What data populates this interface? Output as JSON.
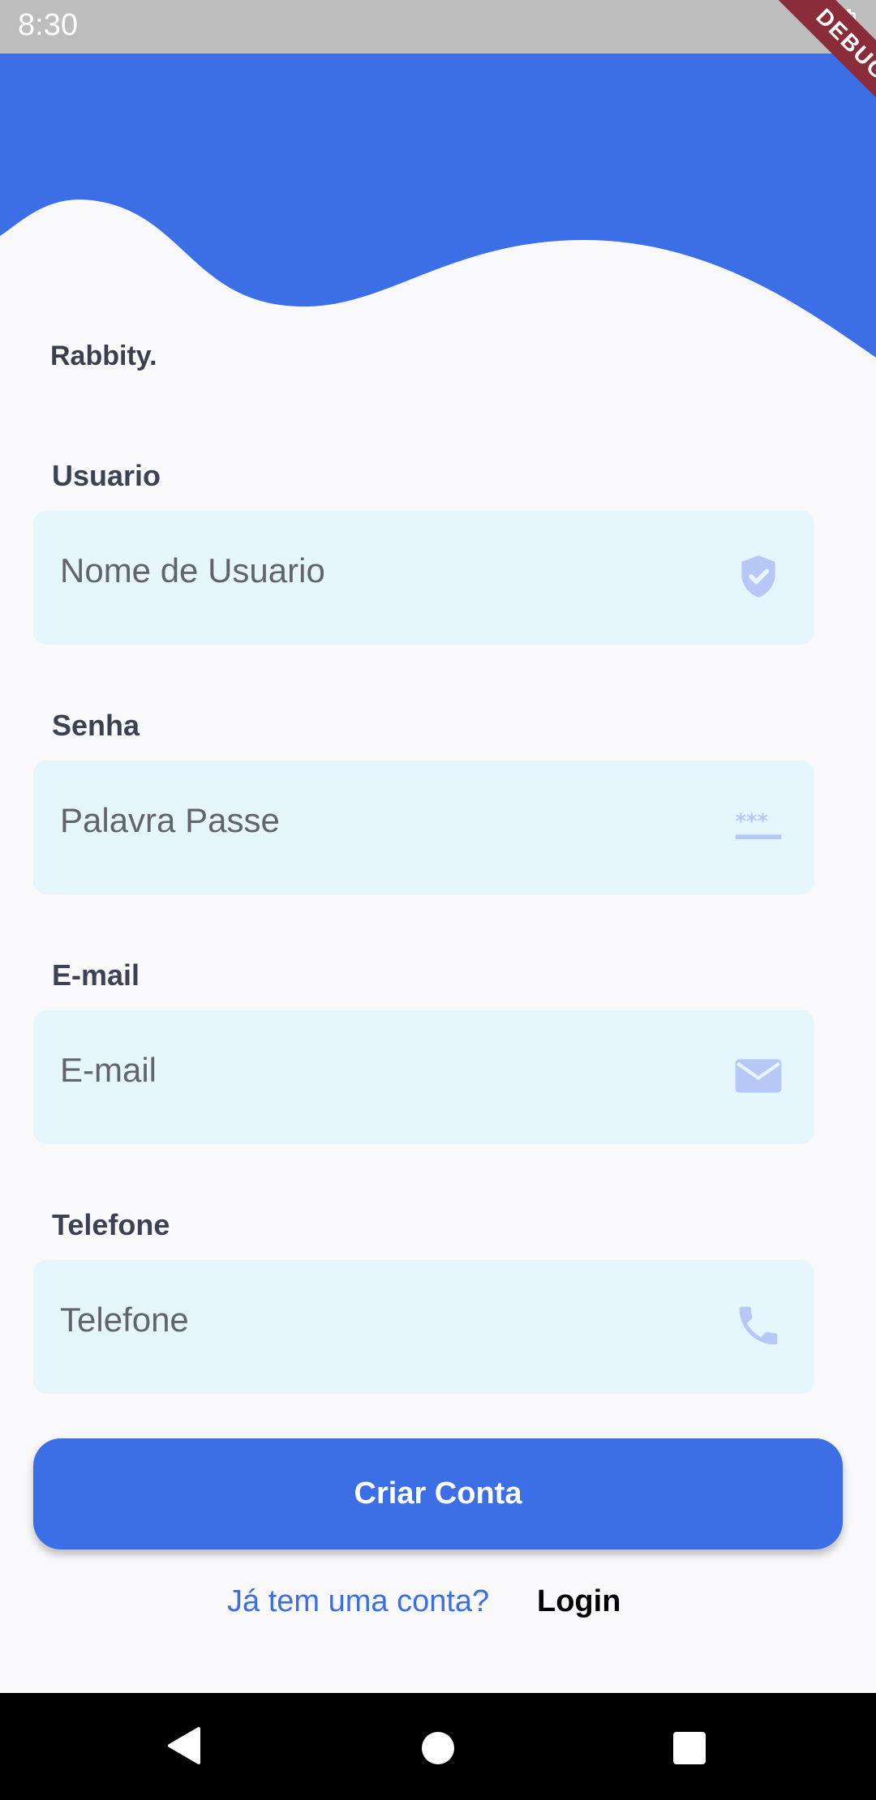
{
  "status": {
    "time": "8:30"
  },
  "debug_banner": "DEBUG",
  "cut_off_text": "Rabbity.",
  "fields": [
    {
      "label": "Usuario",
      "placeholder": "Nome de Usuario",
      "icon": "shield-check-icon"
    },
    {
      "label": "Senha",
      "placeholder": "Palavra Passe",
      "icon": "password-icon"
    },
    {
      "label": "E-mail",
      "placeholder": "E-mail",
      "icon": "mail-icon"
    },
    {
      "label": "Telefone",
      "placeholder": "Telefone",
      "icon": "phone-icon"
    }
  ],
  "actions": {
    "create_account": "Criar Conta",
    "have_account": "Já tem uma conta?",
    "login": "Login"
  },
  "colors": {
    "primary": "#3c6ee6",
    "field_bg": "#e6f6fd",
    "icon": "#b8c8f6"
  }
}
